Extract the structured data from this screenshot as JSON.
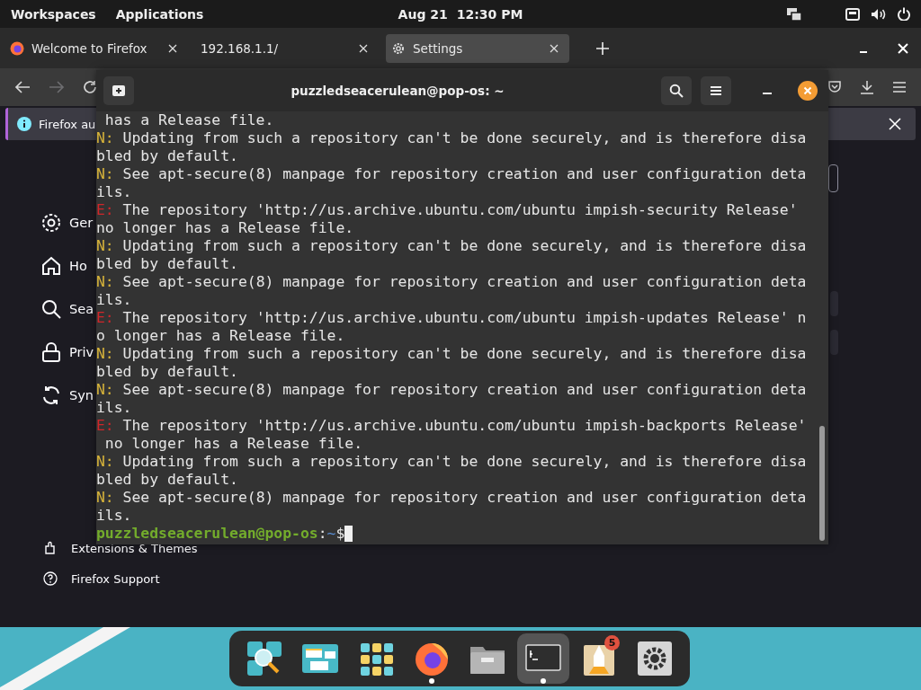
{
  "top_bar": {
    "menus": [
      "Workspaces",
      "Applications"
    ],
    "date": "Aug 21",
    "time": "12:30 PM"
  },
  "browser": {
    "tabs": [
      {
        "title": "Welcome to Firefox",
        "selected": false
      },
      {
        "title": "192.168.1.1/",
        "selected": false
      },
      {
        "title": "Settings",
        "selected": true
      }
    ],
    "nav": [
      {
        "kind": "back",
        "disabled": false
      },
      {
        "kind": "forward",
        "disabled": true
      },
      {
        "kind": "reload",
        "disabled": false
      }
    ],
    "notification": "Firefox au",
    "sidebar": [
      "Ger",
      "Ho",
      "Sea",
      "Priv",
      "Syn"
    ],
    "footer_links": [
      "Extensions & Themes",
      "Firefox Support"
    ]
  },
  "terminal": {
    "title": "puzzledseacerulean@pop-os: ~",
    "lines": [
      {
        "kind": "cont",
        "text": " has a Release file."
      },
      {
        "kind": "note",
        "prefix": "N:",
        "text": " Updating from such a repository can't be done securely, and is therefore disa"
      },
      {
        "kind": "cont",
        "text": "bled by default."
      },
      {
        "kind": "note",
        "prefix": "N:",
        "text": " See apt-secure(8) manpage for repository creation and user configuration deta"
      },
      {
        "kind": "cont",
        "text": "ils."
      },
      {
        "kind": "error",
        "prefix": "E:",
        "text": " The repository 'http://us.archive.ubuntu.com/ubuntu impish-security Release'"
      },
      {
        "kind": "cont",
        "text": "no longer has a Release file."
      },
      {
        "kind": "note",
        "prefix": "N:",
        "text": " Updating from such a repository can't be done securely, and is therefore disa"
      },
      {
        "kind": "cont",
        "text": "bled by default."
      },
      {
        "kind": "note",
        "prefix": "N:",
        "text": " See apt-secure(8) manpage for repository creation and user configuration deta"
      },
      {
        "kind": "cont",
        "text": "ils."
      },
      {
        "kind": "error",
        "prefix": "E:",
        "text": " The repository 'http://us.archive.ubuntu.com/ubuntu impish-updates Release' n"
      },
      {
        "kind": "cont",
        "text": "o longer has a Release file."
      },
      {
        "kind": "note",
        "prefix": "N:",
        "text": " Updating from such a repository can't be done securely, and is therefore disa"
      },
      {
        "kind": "cont",
        "text": "bled by default."
      },
      {
        "kind": "note",
        "prefix": "N:",
        "text": " See apt-secure(8) manpage for repository creation and user configuration deta"
      },
      {
        "kind": "cont",
        "text": "ils."
      },
      {
        "kind": "error",
        "prefix": "E:",
        "text": " The repository 'http://us.archive.ubuntu.com/ubuntu impish-backports Release'"
      },
      {
        "kind": "cont",
        "text": " no longer has a Release file."
      },
      {
        "kind": "note",
        "prefix": "N:",
        "text": " Updating from such a repository can't be done securely, and is therefore disa"
      },
      {
        "kind": "cont",
        "text": "bled by default."
      },
      {
        "kind": "note",
        "prefix": "N:",
        "text": " See apt-secure(8) manpage for repository creation and user configuration deta"
      },
      {
        "kind": "cont",
        "text": "ils."
      }
    ],
    "prompt": {
      "user": "puzzledseacerulean@pop-os",
      "sep": ":",
      "path": "~",
      "symbol": "$"
    }
  },
  "dock": [
    {
      "running": false,
      "selected": false
    },
    {
      "running": false,
      "selected": false
    },
    {
      "running": false,
      "selected": false
    },
    {
      "running": true,
      "selected": false
    },
    {
      "running": false,
      "selected": false
    },
    {
      "running": true,
      "selected": true
    },
    {
      "running": false,
      "selected": false,
      "badge": "5"
    },
    {
      "running": false,
      "selected": false
    }
  ]
}
